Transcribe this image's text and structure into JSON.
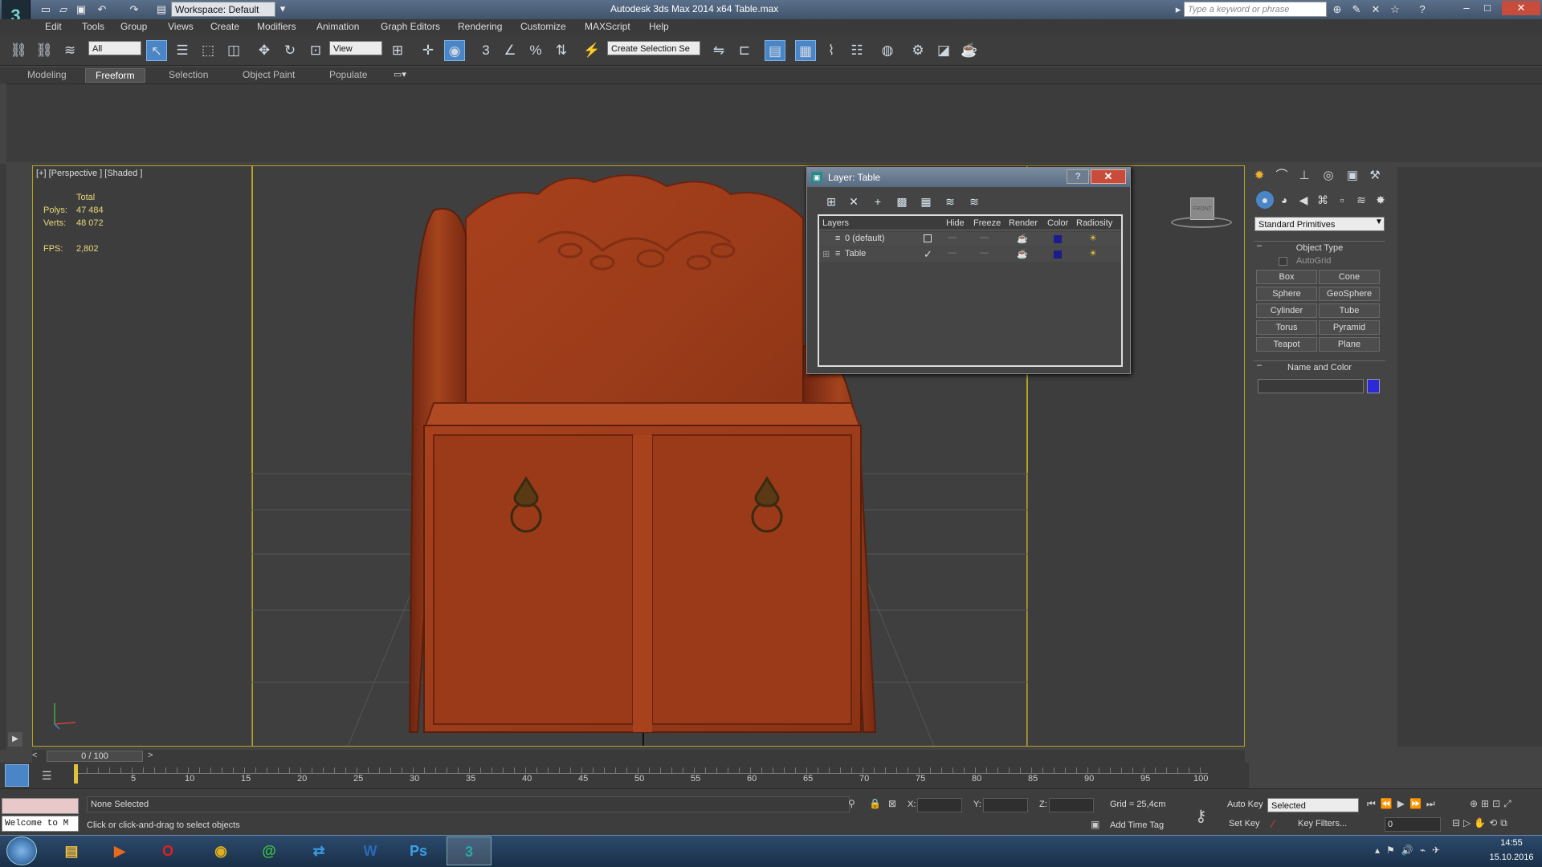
{
  "titlebar": {
    "workspace": "Workspace: Default",
    "app_title": "Autodesk 3ds Max  2014 x64      Table.max",
    "search_placeholder": "Type a keyword or phrase"
  },
  "menu": [
    "Edit",
    "Tools",
    "Group",
    "Views",
    "Create",
    "Modifiers",
    "Animation",
    "Graph Editors",
    "Rendering",
    "Customize",
    "MAXScript",
    "Help"
  ],
  "toolbar": {
    "selection_filter": "All",
    "reference_coord": "View",
    "named_selection": "Create Selection Se"
  },
  "ribbon_tabs": [
    "Modeling",
    "Freeform",
    "Selection",
    "Object Paint",
    "Populate"
  ],
  "ribbon_active": "Freeform",
  "viewport": {
    "label": "[+] [Perspective ] [Shaded ]",
    "stats_total": "Total",
    "polys_label": "Polys:",
    "polys_value": "47 484",
    "verts_label": "Verts:",
    "verts_value": "48 072",
    "fps_label": "FPS:",
    "fps_value": "2,802",
    "viewcube_label": "FRONT"
  },
  "layer_dialog": {
    "title": "Layer: Table",
    "help": "?",
    "columns": [
      "Layers",
      "Hide",
      "Freeze",
      "Render",
      "Color",
      "Radiosity"
    ],
    "rows": [
      {
        "name": "0 (default)",
        "current": false,
        "color": "#1c1c8c"
      },
      {
        "name": "Table",
        "current": true,
        "color": "#1c1c8c"
      }
    ]
  },
  "command_panel": {
    "category": "Standard Primitives",
    "object_type_header": "Object Type",
    "autogrid": "AutoGrid",
    "buttons": [
      "Box",
      "Cone",
      "Sphere",
      "GeoSphere",
      "Cylinder",
      "Tube",
      "Torus",
      "Pyramid",
      "Teapot",
      "Plane"
    ],
    "name_color_header": "Name and Color",
    "object_color": "#2a2ad8"
  },
  "timeline": {
    "frame_display": "0 / 100",
    "ticks": [
      "5",
      "10",
      "15",
      "20",
      "25",
      "30",
      "35",
      "40",
      "45",
      "50",
      "55",
      "60",
      "65",
      "70",
      "75",
      "80",
      "85",
      "90",
      "95",
      "100"
    ]
  },
  "status": {
    "maxscript": "Welcome to M",
    "selection": "None Selected",
    "prompt": "Click or click-and-drag to select objects",
    "x_label": "X:",
    "y_label": "Y:",
    "z_label": "Z:",
    "grid": "Grid = 25,4cm",
    "add_time_tag": "Add Time Tag",
    "auto_key": "Auto Key",
    "set_key": "Set Key",
    "selected": "Selected",
    "key_filters": "Key Filters...",
    "frame": "0"
  },
  "taskbar": {
    "time": "14:55",
    "date": "15.10.2016",
    "apps": [
      "W",
      "Ps"
    ]
  }
}
